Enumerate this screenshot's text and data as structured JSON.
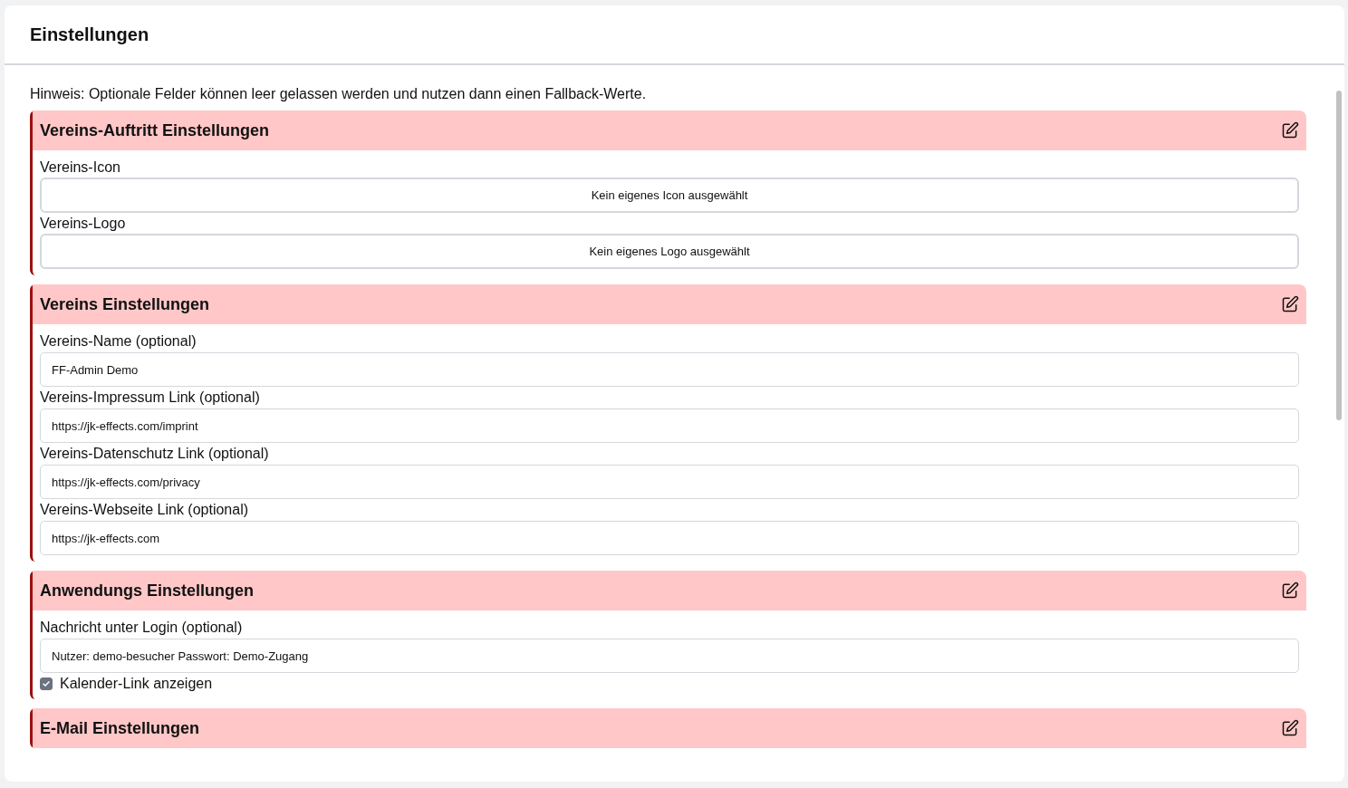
{
  "title": "Einstellungen",
  "hint": "Hinweis: Optionale Felder können leer gelassen werden und nutzen dann einen Fallback-Werte.",
  "sections": [
    {
      "title": "Vereins-Auftritt Einstellungen",
      "fields": [
        {
          "kind": "file",
          "label": "Vereins-Icon",
          "value": "Kein eigenes Icon ausgewählt"
        },
        {
          "kind": "file",
          "label": "Vereins-Logo",
          "value": "Kein eigenes Logo ausgewählt"
        }
      ]
    },
    {
      "title": "Vereins Einstellungen",
      "fields": [
        {
          "kind": "text",
          "label": "Vereins-Name (optional)",
          "value": "FF-Admin Demo"
        },
        {
          "kind": "text",
          "label": "Vereins-Impressum Link (optional)",
          "value": "https://jk-effects.com/imprint"
        },
        {
          "kind": "text",
          "label": "Vereins-Datenschutz Link (optional)",
          "value": "https://jk-effects.com/privacy"
        },
        {
          "kind": "text",
          "label": "Vereins-Webseite Link (optional)",
          "value": "https://jk-effects.com"
        }
      ]
    },
    {
      "title": "Anwendungs Einstellungen",
      "fields": [
        {
          "kind": "text",
          "label": "Nachricht unter Login (optional)",
          "value": "Nutzer: demo-besucher Passwort: Demo-Zugang"
        },
        {
          "kind": "checkbox",
          "label": "Kalender-Link anzeigen",
          "checked": true
        }
      ]
    },
    {
      "title": "E-Mail Einstellungen"
    }
  ]
}
